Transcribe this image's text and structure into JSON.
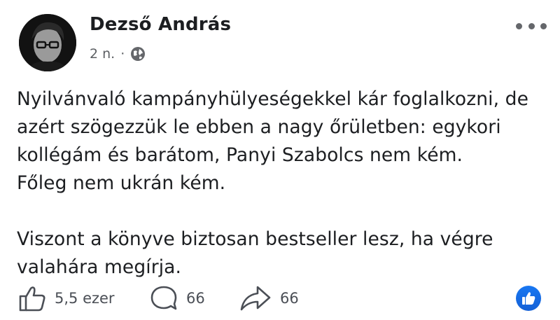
{
  "post": {
    "author": "Dezső András",
    "timestamp": "2 n.",
    "separator": "·",
    "audience_icon": "globe-icon",
    "menu_icon": "more-options-icon",
    "lines": [
      "Nyilvánvaló kampányhülyeségekkel kár foglalkozni, de",
      "azért szögezzük le ebben a nagy őrületben: egykori",
      "kollégám és barátom, Panyi Szabolcs nem kém.",
      "Főleg nem ukrán kém."
    ],
    "lines2": [
      "Viszont a könyve biztosan bestseller lesz, ha végre",
      "valahára megírja."
    ]
  },
  "actions": {
    "like_count": "5,5 ezer",
    "comment_count": "66",
    "share_count": "66"
  },
  "colors": {
    "text": "#1c1e21",
    "secondary": "#65676b",
    "accent": "#1877f2"
  }
}
